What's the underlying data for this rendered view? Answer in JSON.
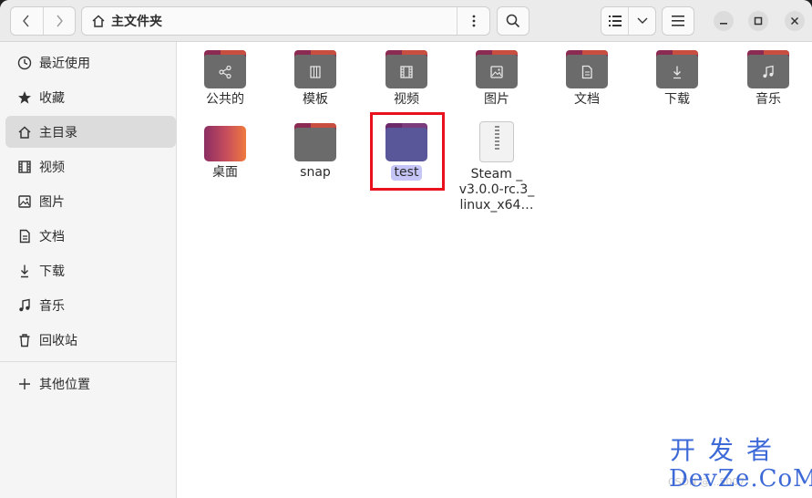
{
  "header": {
    "location": "主文件夹",
    "icons": {
      "back": "chevron-left-icon",
      "forward": "chevron-right-icon",
      "home": "home-icon",
      "path_menu": "vertical-dots-icon",
      "search": "search-icon",
      "list_view": "list-view-icon",
      "view_options": "chevron-down-icon",
      "main_menu": "hamburger-icon",
      "minimize": "minimize-icon",
      "maximize": "maximize-icon",
      "close": "close-icon"
    }
  },
  "sidebar": {
    "items": [
      {
        "label": "最近使用",
        "icon": "clock-icon"
      },
      {
        "label": "收藏",
        "icon": "star-icon"
      },
      {
        "label": "主目录",
        "icon": "home-icon",
        "active": true
      },
      {
        "label": "视频",
        "icon": "film-icon"
      },
      {
        "label": "图片",
        "icon": "image-icon"
      },
      {
        "label": "文档",
        "icon": "document-icon"
      },
      {
        "label": "下载",
        "icon": "download-icon"
      },
      {
        "label": "音乐",
        "icon": "music-icon"
      },
      {
        "label": "回收站",
        "icon": "trash-icon"
      }
    ],
    "other": {
      "label": "其他位置",
      "icon": "plus-icon"
    }
  },
  "files": [
    {
      "name": "公共的",
      "type": "folder",
      "emblem": "share-icon"
    },
    {
      "name": "模板",
      "type": "folder",
      "emblem": "template-icon"
    },
    {
      "name": "视频",
      "type": "folder",
      "emblem": "film-icon"
    },
    {
      "name": "图片",
      "type": "folder",
      "emblem": "image-icon"
    },
    {
      "name": "文档",
      "type": "folder",
      "emblem": "document-icon"
    },
    {
      "name": "下载",
      "type": "folder",
      "emblem": "download-icon"
    },
    {
      "name": "音乐",
      "type": "folder",
      "emblem": "music-icon"
    },
    {
      "name": "桌面",
      "type": "folder",
      "emblem": "desktop-gradient"
    },
    {
      "name": "snap",
      "type": "folder"
    },
    {
      "name": "test",
      "type": "folder",
      "selected": true
    },
    {
      "name_lines": [
        "Steam _",
        "v3.0.0-rc.3_",
        "linux_x64…"
      ],
      "type": "archive"
    }
  ],
  "colors": {
    "folder_tab": "#8b2a52",
    "folder_body": "#6b6b6b",
    "selection": "#c5c5f7",
    "highlight_box": "#e8111d",
    "watermark": "#3e6ad8"
  },
  "watermark": {
    "cn": "开发者",
    "en": "DevZe.CoM",
    "faint": "CSDN @...5007"
  }
}
